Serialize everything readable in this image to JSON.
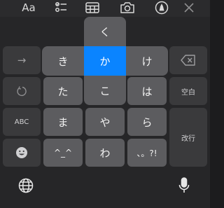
{
  "toolbar": {
    "font_label": "Aa",
    "icons": [
      "checklist-icon",
      "table-icon",
      "camera-icon",
      "markup-pen-icon",
      "close-icon"
    ]
  },
  "flick_popup": {
    "up": "く",
    "left": "き",
    "center": "か",
    "right": "け",
    "down": "こ"
  },
  "keyboard": {
    "row1": {
      "left": "→",
      "kana_mid_hidden": "",
      "right_icon": "delete-icon"
    },
    "row2": {
      "left_icon": "undo-icon",
      "k1": "た",
      "k3": "は",
      "right": "空白"
    },
    "row3": {
      "left": "ABC",
      "k1": "ま",
      "k2": "や",
      "k3": "ら",
      "right": "改行"
    },
    "row4": {
      "left_icon": "emoji-icon",
      "k1": "^_^",
      "k2": "わ",
      "k3": "、。?!"
    }
  },
  "bottom": {
    "icons": [
      "globe-icon",
      "microphone-icon"
    ]
  },
  "colors": {
    "accent": "#0a84ff",
    "key": "#5c5c5f",
    "function_key": "#3a3a3c"
  }
}
